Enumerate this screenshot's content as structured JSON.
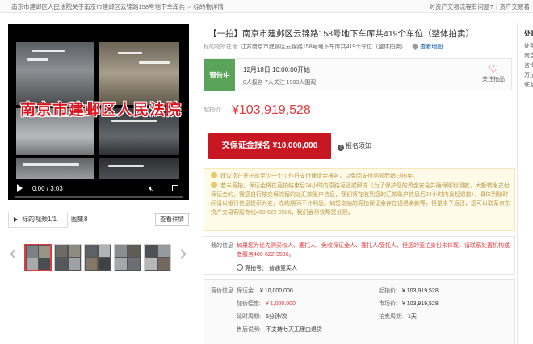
{
  "breadcrumb": {
    "items": [
      "南京市建邺区人民法院关于南京市建邺区云锦路158号地下车库共",
      "标的物详情"
    ],
    "separator": ">"
  },
  "top_links": {
    "left": "对资产交易流程有问题?",
    "right": "资产交易着"
  },
  "video": {
    "caption": "南京市建邺区人民法院",
    "time": "0:00 / 3:03",
    "icons": [
      "play-icon",
      "mute-icon",
      "fullscreen-icon"
    ]
  },
  "media_tabs": {
    "video_label": "标的视频1/1",
    "image_label": "图集8",
    "detail_button": "查看详情"
  },
  "title": "【一拍】南京市建邺区云锦路158号地下车库共419个车位（整体拍卖）",
  "location": {
    "label": "标的物所在地:",
    "address": "江苏南京市建邺区云锦路158号地下车库共419个车位（整体拍卖）",
    "map_link": "查看地图"
  },
  "status": {
    "badge": "预告中",
    "start_time": "12月18日 10:00:00开始",
    "stats": "0人报名  7人关注  1903人围观",
    "follow_label": "关注拍品"
  },
  "price": {
    "label": "起拍价:",
    "value": "¥103,919,528"
  },
  "actions": {
    "bid_button": "交保证金报名 ¥10,000,000",
    "notice": "报名须知"
  },
  "tips": {
    "tip1": "建议您在开拍前至少一个工作日支付保证金报名，以免因支付问题而错过拍卖。",
    "tip2": "若未竞拍，保证金将在竞拍结束后24小时内原路返还或解冻（为了保护您的资金安全并确保顺利退款，大额转账支付保证金的，需您自行按交保流程的派汇款账户信息，我们将在收到您的汇款账户信息后24小时内发起退款），具体到账时间请以银行信息提示为准，冻结期间不计利息。如您交纳的竞拍保证金存在误退余款等，但是未予返还，您可以联系京东资产交易客服专线400-622-9586，我们会尽快帮您处理。"
  },
  "my_info": {
    "label": "我的信息",
    "warning": "如果您为优先购买权人、委托人、免收保证金人、委托人/受托人、但您的竞拍身份未体现，请联系处置机构或者服务400-622-9586。",
    "bid_number": "竞拍号：  ",
    "bidder_type": "普通竞买人"
  },
  "auction_info": {
    "label": "竞价信息",
    "deposit": {
      "k": "保证金:",
      "v": "¥ 10,000,000"
    },
    "increment": {
      "k": "加价幅度:",
      "v": "¥ 1,000,000"
    },
    "delay": {
      "k": "延时周期:",
      "v": "5分钟/次"
    },
    "notes": {
      "k": "售后说明:",
      "v": "不支持七天无理由退货"
    },
    "start_price": {
      "k": "起拍价:",
      "v": "¥ 103,919,528"
    },
    "market_price": {
      "k": "市场价:",
      "v": "¥ 103,919,528"
    },
    "auction_cycle": {
      "k": "拍卖周期:",
      "v": "1天"
    }
  },
  "side": {
    "title": "处置",
    "lines": [
      "处置单",
      "南京",
      "咨询",
      "万法",
      "联系"
    ]
  },
  "colors": {
    "accent": "#e4393c",
    "button": "#c81623",
    "badge": "#5aa45a",
    "link": "#005aa0",
    "tip_bg": "#fffbe8"
  }
}
